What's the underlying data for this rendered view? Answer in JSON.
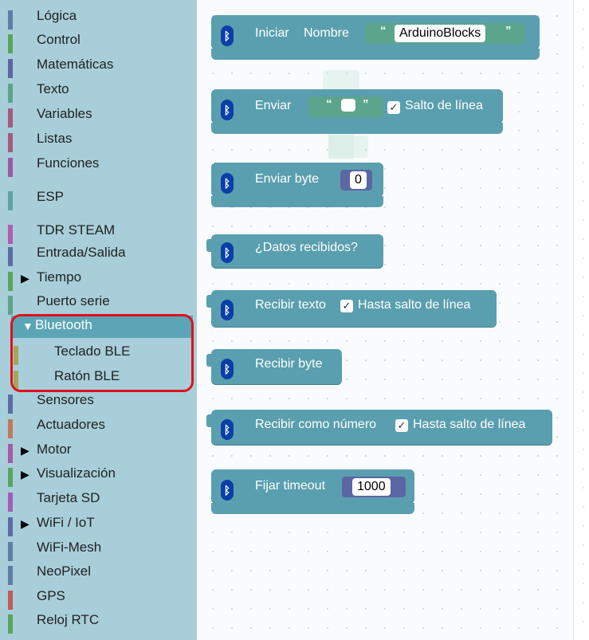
{
  "sidebar": {
    "categories": [
      {
        "label": "Lógica",
        "color": "#5b80a5"
      },
      {
        "label": "Control",
        "color": "#5ba55b"
      },
      {
        "label": "Matemáticas",
        "color": "#5b67a5"
      },
      {
        "label": "Texto",
        "color": "#5ba58c"
      },
      {
        "label": "Variables",
        "color": "#a55b80"
      },
      {
        "label": "Listas",
        "color": "#a55b80"
      },
      {
        "label": "Funciones",
        "color": "#995ba5"
      },
      {
        "label": "ESP",
        "color": "#5ba5a5"
      },
      {
        "label": "TDR STEAM",
        "color": "#b25bb2"
      },
      {
        "label": "Entrada/Salida",
        "color": "#5b6ea5"
      },
      {
        "label": "Tiempo",
        "color": "#5ba55b",
        "arrow": "▶"
      },
      {
        "label": "Puerto serie",
        "color": "#5ba58c"
      },
      {
        "label": "Bluetooth",
        "color": "#5ba5b6",
        "arrow": "▼",
        "selected": true
      },
      {
        "label": "Teclado BLE",
        "color": "#a5a55b",
        "sub": true
      },
      {
        "label": "Ratón BLE",
        "color": "#a5a55b",
        "sub": true
      },
      {
        "label": "Sensores",
        "color": "#5b6ea5"
      },
      {
        "label": "Actuadores",
        "color": "#c07a5b"
      },
      {
        "label": "Motor",
        "color": "#a55ba5",
        "arrow": "▶"
      },
      {
        "label": "Visualización",
        "color": "#5ba55b",
        "arrow": "▶"
      },
      {
        "label": "Tarjeta SD",
        "color": "#a55bb8"
      },
      {
        "label": "WiFi / IoT",
        "color": "#5b6ea5",
        "arrow": "▶"
      },
      {
        "label": "WiFi-Mesh",
        "color": "#5b80a5"
      },
      {
        "label": "NeoPixel",
        "color": "#5b80a5"
      },
      {
        "label": "GPS",
        "color": "#c05b5b"
      },
      {
        "label": "Reloj RTC",
        "color": "#5ba55b"
      }
    ]
  },
  "blocks": {
    "iniciar": {
      "label": "Iniciar",
      "nombre": "Nombre",
      "value": "ArduinoBlocks",
      "q_open": "“",
      "q_close": "”"
    },
    "enviar": {
      "label": "Enviar",
      "q_open": "“",
      "q_close": "”",
      "checkbox": "✓",
      "option": "Salto de línea"
    },
    "enviar_byte": {
      "label": "Enviar byte",
      "value": "0"
    },
    "datos_recibidos": {
      "label": "¿Datos recibidos?"
    },
    "recibir_texto": {
      "label": "Recibir texto",
      "checkbox": "✓",
      "option": "Hasta salto de línea"
    },
    "recibir_byte": {
      "label": "Recibir byte"
    },
    "recibir_numero": {
      "label": "Recibir como número",
      "checkbox": "✓",
      "option": "Hasta salto de línea"
    },
    "fijar_timeout": {
      "label": "Fijar timeout",
      "value": "1000"
    }
  },
  "icons": {
    "bluetooth": "bluetooth-icon",
    "glyph": "ᛒ"
  },
  "colors": {
    "block": "#5a9faf",
    "sidebar": "#a8cfd9",
    "highlight": "#e0101e",
    "bt_icon": "#0a3ea8"
  }
}
